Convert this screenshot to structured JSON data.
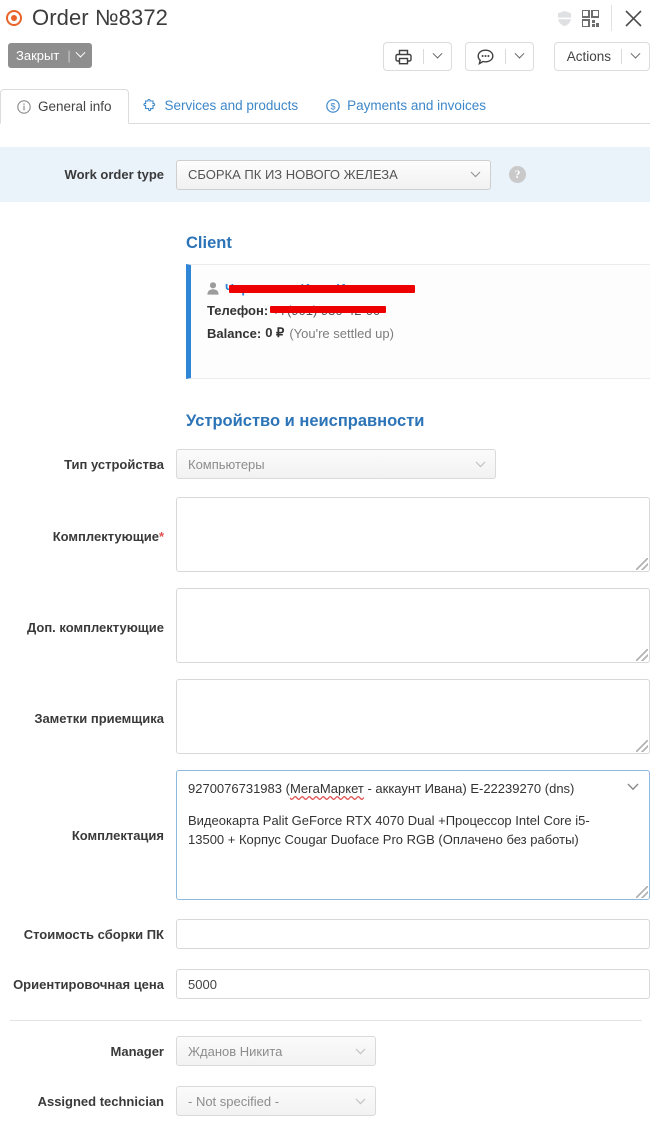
{
  "window": {
    "title": "Order №8372",
    "rec_icon": "record-target-icon",
    "shield_icon": "shield-icon",
    "qr_icon": "qr-code-icon",
    "close_icon": "close-icon",
    "accent_orange": "#e8622a"
  },
  "toolbar": {
    "status_label": "Закрыт",
    "status_color": "#8e8e8e",
    "print_icon": "printer-icon",
    "chat_icon": "chat-bubble-icon",
    "actions_label": "Actions"
  },
  "tabs": [
    {
      "label": "General info",
      "icon": "info-circle-icon",
      "active": true
    },
    {
      "label": "Services and products",
      "icon": "puzzle-piece-icon",
      "active": false
    },
    {
      "label": "Payments and invoices",
      "icon": "dollar-circle-icon",
      "active": false
    }
  ],
  "work_order": {
    "label": "Work order type",
    "value": "СБОРКА ПК ИЗ НОВОГО ЖЕЛЕЗА",
    "help_icon": "question-mark-icon",
    "band_color": "#eaf2fa"
  },
  "client": {
    "heading": "Client",
    "person_icon": "person-icon",
    "name": "Черкашина Иван Иванович",
    "phone_label": "Телефон:",
    "phone": "+7(901) 930-42-00",
    "balance_label": "Balance:",
    "balance_value": "0 ₽",
    "balance_note": "(You're settled up)",
    "accent": "#2f86d6"
  },
  "device": {
    "heading": "Устройство и неисправности",
    "type_label": "Тип устройства",
    "type_value": "Компьютеры",
    "components_label": "Комплектующие",
    "components_required": "*",
    "components_value": "",
    "extra_components_label": "Доп. комплектующие",
    "extra_components_value": "",
    "receiver_notes_label": "Заметки приемщика",
    "receiver_notes_value": "",
    "kit_label": "Комплектация",
    "kit_line1": "9270076731983 (МегаМаркет - аккаунт Ивана) E-22239270 (dns)",
    "kit_line1_squiggle": "МегаМаркет",
    "kit_line2": "Видеокарта Palit GeForce RTX 4070 Dual +Процессор Intel Core i5-13500 + Корпус Cougar Duoface Pro RGB (Оплачено без работы)",
    "kit_chevron_icon": "chevron-down-icon"
  },
  "pricing": {
    "build_cost_label": "Стоимость сборки ПК",
    "build_cost_value": "",
    "estimate_label": "Ориентировочная цена",
    "estimate_value": "5000"
  },
  "assignment": {
    "manager_label": "Manager",
    "manager_value": "Жданов Никита",
    "technician_label": "Assigned technician",
    "technician_value": "- Not specified -"
  }
}
